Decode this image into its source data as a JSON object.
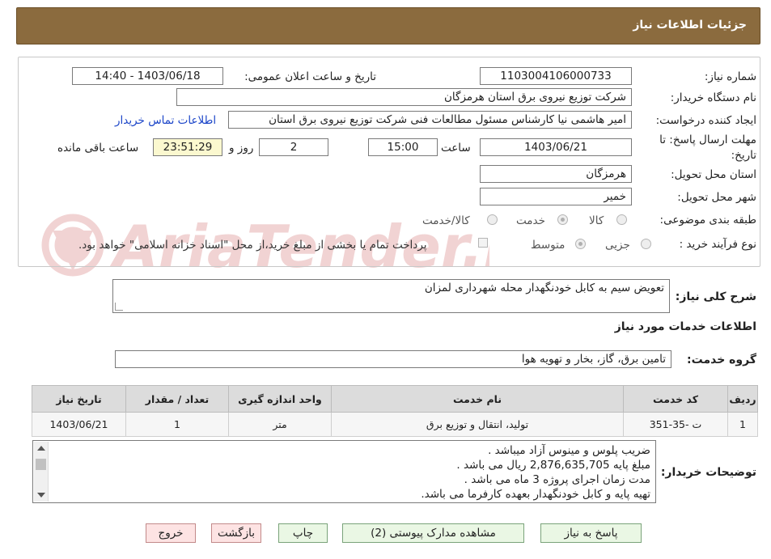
{
  "header": {
    "title": "جزئیات اطلاعات نیاز"
  },
  "form": {
    "need_number": {
      "label": "شماره نیاز:",
      "value": "1103004106000733"
    },
    "announce_datetime": {
      "label": "تاریخ و ساعت اعلان عمومی:",
      "value": "1403/06/18 - 14:40"
    },
    "buyer_org": {
      "label": "نام دستگاه خریدار:",
      "value": "شرکت توزیع نیروی برق استان هرمزگان"
    },
    "requester": {
      "label": "ایجاد کننده درخواست:",
      "value": "امیر هاشمی نیا کارشناس مسئول مطالعات فنی شرکت توزیع نیروی برق استان"
    },
    "buyer_contact_link": "اطلاعات تماس خریدار",
    "deadline": {
      "label_line1": "مهلت ارسال پاسخ: تا",
      "label_line2": "تاریخ:",
      "date": "1403/06/21",
      "time_label": "ساعت",
      "time": "15:00",
      "days": "2",
      "days_label": "روز و",
      "remaining": "23:51:29",
      "remaining_label": "ساعت باقی مانده"
    },
    "delivery_province": {
      "label": "استان محل تحویل:",
      "value": "هرمزگان"
    },
    "delivery_city": {
      "label": "شهر محل تحویل:",
      "value": "خمیر"
    },
    "category": {
      "label": "طبقه بندی موضوعی:",
      "options": [
        "کالا",
        "خدمت",
        "کالا/خدمت"
      ],
      "selected": "خدمت"
    },
    "purchase_process": {
      "label": "نوع فرآیند خرید :",
      "options": [
        "جزیی",
        "متوسط"
      ],
      "selected": "متوسط",
      "payment_note": "پرداخت تمام یا بخشی از مبلغ خرید،از محل \"اسناد خزانه اسلامی\" خواهد بود."
    }
  },
  "summary": {
    "label": "شرح کلی نیاز:",
    "value": "تعویض سیم به کابل خودنگهدار محله شهرداری لمزان"
  },
  "services_title": "اطلاعات خدمات مورد نیاز",
  "service_group": {
    "label": "گروه خدمت:",
    "value": "تامین برق، گاز، بخار و تهویه هوا"
  },
  "table": {
    "headers": [
      "ردیف",
      "کد خدمت",
      "نام خدمت",
      "واحد اندازه گیری",
      "تعداد / مقدار",
      "تاریخ نیاز"
    ],
    "rows": [
      [
        "1",
        "ت -35-351",
        "تولید، انتقال و توزیع برق",
        "متر",
        "1",
        "1403/06/21"
      ]
    ]
  },
  "buyer_notes": {
    "label": "توضیحات خریدار:",
    "lines": [
      "ضریب پلوس و مینوس آزاد میباشد .",
      "مبلغ پایه 2,876,635,705 ریال می باشد .",
      "مدت زمان اجرای پروژه 3 ماه می باشد .",
      "تهیه پایه و کابل خودنگهدار بعهده کارفرما می باشد."
    ]
  },
  "buttons": {
    "reply": "پاسخ به نیاز",
    "attachments": "مشاهده مدارک پیوستی (2)",
    "print": "چاپ",
    "back": "بازگشت",
    "exit": "خروج"
  },
  "watermark": {
    "text": "AriaTender.neT"
  },
  "colors": {
    "header_bg": "#8b6b3e",
    "link": "#1a44c8",
    "remaining_bg": "#fbf8cf"
  }
}
